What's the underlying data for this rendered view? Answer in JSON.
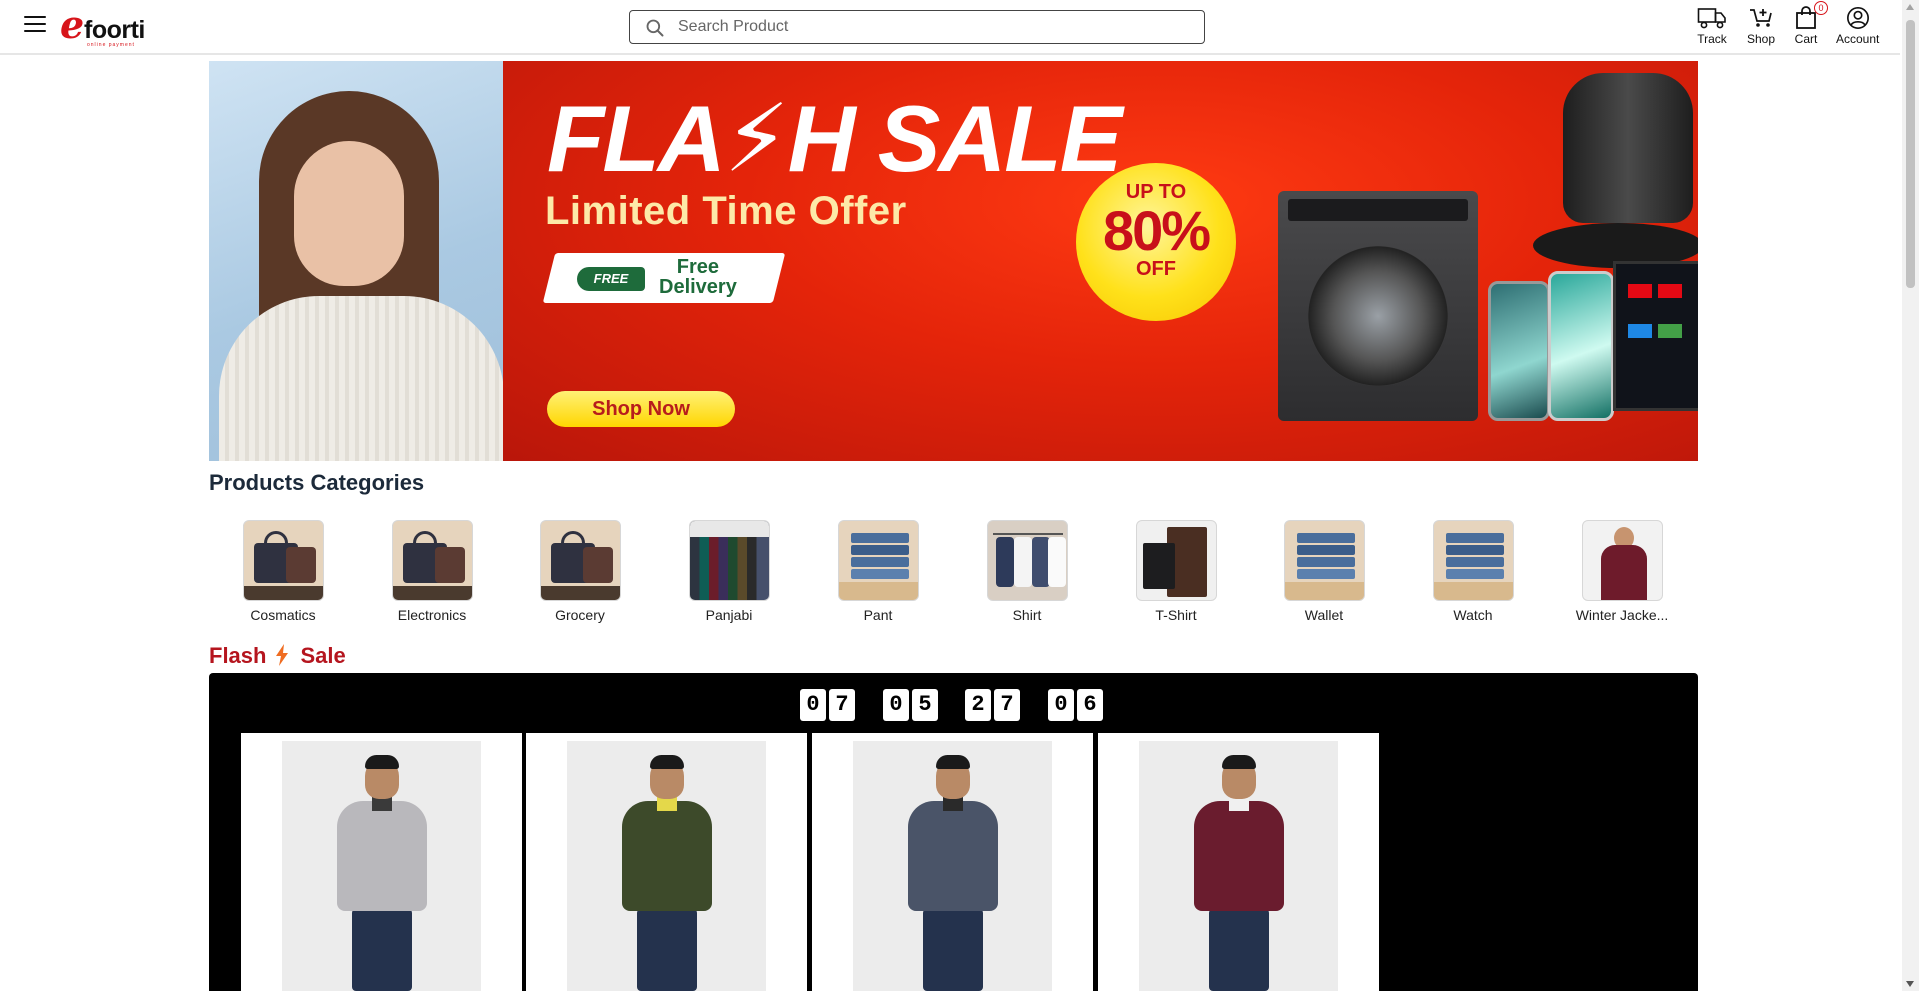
{
  "header": {
    "logo_text": "efoorti",
    "logo_tagline": "online payment",
    "search_placeholder": "Search Product",
    "nav": {
      "track": "Track",
      "shop": "Shop",
      "cart": "Cart",
      "cart_count": "0",
      "account": "Account"
    }
  },
  "banner": {
    "title": "FLA⚡H SALE",
    "subtitle": "Limited Time Offer",
    "free_tag": "FREE",
    "free_delivery_line1": "Free",
    "free_delivery_line2": "Delivery",
    "discount_top": "UP TO",
    "discount_value": "80%",
    "discount_bottom": "OFF",
    "cta": "Shop Now",
    "colors": {
      "background": "#e4240a",
      "accent": "#ffe11a"
    }
  },
  "categories": {
    "title": "Products Categories",
    "items": [
      {
        "name": "Cosmatics",
        "image": "bag"
      },
      {
        "name": "Electronics",
        "image": "bag"
      },
      {
        "name": "Grocery",
        "image": "bag"
      },
      {
        "name": "Panjabi",
        "image": "panjabi-rack"
      },
      {
        "name": "Pant",
        "image": "pant-stack"
      },
      {
        "name": "Shirt",
        "image": "shirt-rack"
      },
      {
        "name": "T-Shirt",
        "image": "wallets"
      },
      {
        "name": "Wallet",
        "image": "pant-stack"
      },
      {
        "name": "Watch",
        "image": "pant-stack"
      },
      {
        "name": "Winter Jacke...",
        "image": "jacket-model"
      }
    ]
  },
  "flash_sale": {
    "title_left": "Flash",
    "title_right": "Sale",
    "bolt_icon": "lightning-icon",
    "timer": [
      "0",
      "7",
      "0",
      "5",
      "2",
      "7",
      "0",
      "6"
    ],
    "products": [
      {
        "image": "grey-jacket-model",
        "jacket_color": "#b9b8bc"
      },
      {
        "image": "olive-jacket-model",
        "jacket_color": "#3d4a2a"
      },
      {
        "image": "navy-jacket-model",
        "jacket_color": "#4a5468"
      },
      {
        "image": "maroon-jacket-model",
        "jacket_color": "#6a1c2e"
      }
    ],
    "colors": {
      "title": "#b5151e",
      "box": "#000000"
    }
  }
}
